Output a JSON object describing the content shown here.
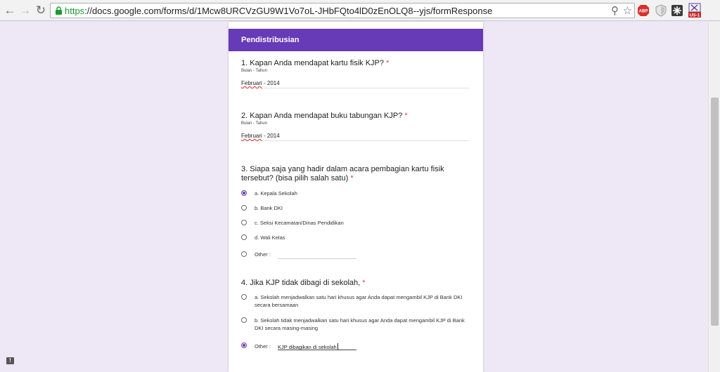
{
  "browser": {
    "url_scheme": "https",
    "url_rest": "://docs.google.com/forms/d/1Mcw8URCVzGU9W1Vo7oL-JHbFQto4lD0zEnOLQ8--yjs/formResponse",
    "icons": [
      "back-arrow-icon",
      "forward-arrow-icon",
      "reload-icon",
      "lock-icon",
      "zoom-icon",
      "star-icon",
      "abp-icon",
      "shield-icon",
      "puzzle-icon",
      "flag-icon"
    ],
    "ext_abp_label": "ABP",
    "ext_flag_label": "US-1"
  },
  "form": {
    "section_title": "Pendistribusian",
    "required_mark": "*",
    "questions": [
      {
        "title": "1. Kapan Anda mendapat kartu fisik KJP?",
        "help": "Bulan - Tahun",
        "answer_word": "Februari",
        "answer_rest": " - 2014"
      },
      {
        "title": "2. Kapan Anda mendapat buku tabungan KJP?",
        "help": "Bulan - Tahun",
        "answer_word": "Februari",
        "answer_rest": " - 2014"
      },
      {
        "title": "3. Siapa saja yang hadir dalam acara pembagian kartu fisik tersebut? (bisa pilih salah satu)",
        "options": [
          {
            "label": "a. Kepala Sekolah",
            "checked": true
          },
          {
            "label": "b. Bank DKI",
            "checked": false
          },
          {
            "label": "c. Seksi Kecamatan/Dinas Pendidikan",
            "checked": false
          },
          {
            "label": "d. Wali Kelas",
            "checked": false
          }
        ],
        "other_label": "Other :",
        "other_value": ""
      },
      {
        "title": "4. Jika KJP tidak dibagi di sekolah,",
        "options": [
          {
            "label": "a. Sekolah menjadwalkan satu hari khusus agar Anda dapat mengambil KJP di Bank DKI secara bersamaan",
            "checked": false
          },
          {
            "label": "b. Sekolah tidak menjadwalkan satu hari khusus agar Anda dapat mengambil KJP di Bank DKI secara masing-masing",
            "checked": false
          }
        ],
        "other_label": "Other :",
        "other_value": "KJP dibagikan di sekolah",
        "other_checked": true
      }
    ]
  },
  "feedback_label": "!",
  "colors": {
    "accent": "#673ab7",
    "page_bg": "#ede7f6",
    "required": "#db4437"
  }
}
